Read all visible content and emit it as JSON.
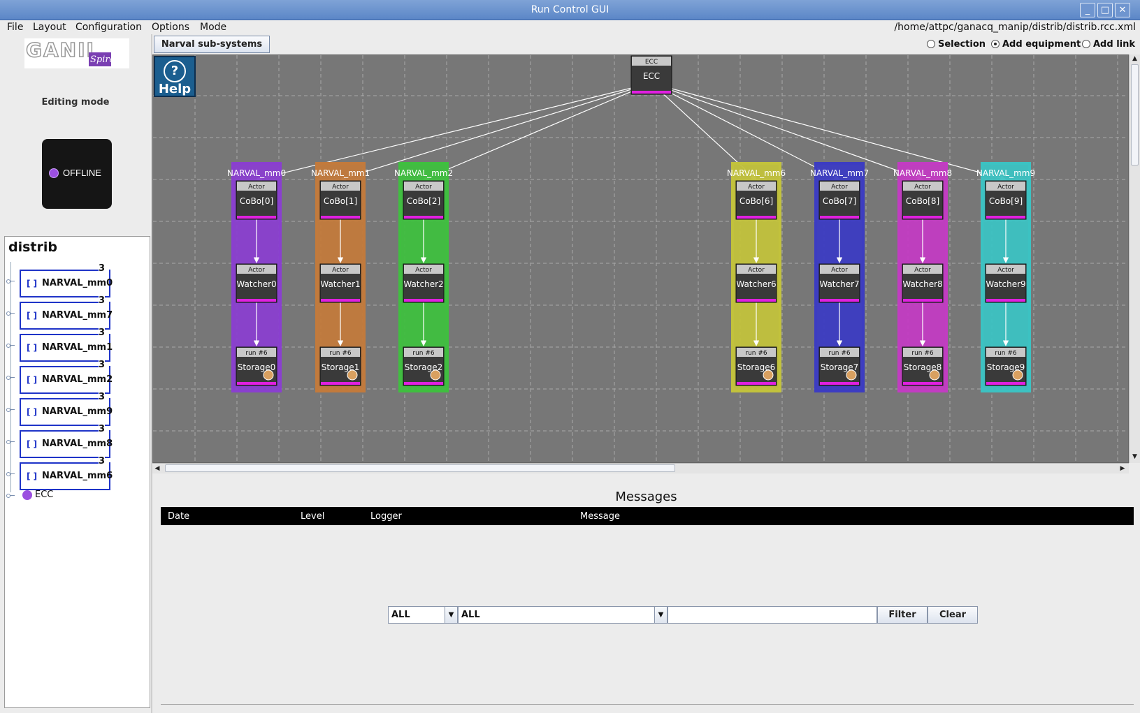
{
  "window": {
    "title": "Run Control GUI",
    "buttons": {
      "minimize": "_",
      "maximize": "□",
      "close": "✕"
    }
  },
  "menu": {
    "items": [
      "File",
      "Layout",
      "Configuration",
      "Options",
      "Mode"
    ],
    "filepath": "/home/attpc/ganacq_manip/distrib/distrib.rcc.xml"
  },
  "left": {
    "mode_label": "Editing mode",
    "state_label": "OFFLINE",
    "tree_root": "distrib",
    "tree_nodes": [
      {
        "name": "NARVAL_mm0",
        "count": "3"
      },
      {
        "name": "NARVAL_mm7",
        "count": "3"
      },
      {
        "name": "NARVAL_mm1",
        "count": "3"
      },
      {
        "name": "NARVAL_mm2",
        "count": "3"
      },
      {
        "name": "NARVAL_mm9",
        "count": "3"
      },
      {
        "name": "NARVAL_mm8",
        "count": "3"
      },
      {
        "name": "NARVAL_mm6",
        "count": "3"
      }
    ],
    "tree_leaf": "ECC",
    "bracket": "[ ]"
  },
  "toolbar": {
    "tab_label": "Narval sub-systems",
    "radio_selection": "Selection",
    "radio_add_equipment": "Add equipment",
    "radio_add_link": "Add link",
    "selected_radio": "Add equipment"
  },
  "canvas": {
    "help_label": "Help",
    "help_glyph": "?",
    "ecc": {
      "header": "ECC",
      "name": "ECC"
    },
    "groups": [
      {
        "label": "NARVAL_mm0",
        "color": "#8a3fcf",
        "cobo": "CoBo[0]",
        "watcher": "Watcher0",
        "storage": "Storage0"
      },
      {
        "label": "NARVAL_mm1",
        "color": "#c27a3c",
        "cobo": "CoBo[1]",
        "watcher": "Watcher1",
        "storage": "Storage1"
      },
      {
        "label": "NARVAL_mm2",
        "color": "#3fbf3f",
        "cobo": "CoBo[2]",
        "watcher": "Watcher2",
        "storage": "Storage2"
      },
      {
        "label": "NARVAL_mm6",
        "color": "#c2c23c",
        "cobo": "CoBo[6]",
        "watcher": "Watcher6",
        "storage": "Storage6"
      },
      {
        "label": "NARVAL_mm7",
        "color": "#3c3cc2",
        "cobo": "CoBo[7]",
        "watcher": "Watcher7",
        "storage": "Storage7"
      },
      {
        "label": "NARVAL_mm8",
        "color": "#c23cc2",
        "cobo": "CoBo[8]",
        "watcher": "Watcher8",
        "storage": "Storage8"
      },
      {
        "label": "NARVAL_mm9",
        "color": "#3cc2c2",
        "cobo": "CoBo[9]",
        "watcher": "Watcher9",
        "storage": "Storage9"
      }
    ],
    "actor_header": "Actor",
    "storage_header": "run #6",
    "node_accent": "#e020e0"
  },
  "messages": {
    "title": "Messages",
    "columns": [
      "Date",
      "Level",
      "Logger",
      "Message"
    ],
    "level_filter": "ALL",
    "logger_filter": "ALL",
    "filter_text": "",
    "filter_button": "Filter",
    "clear_button": "Clear"
  }
}
